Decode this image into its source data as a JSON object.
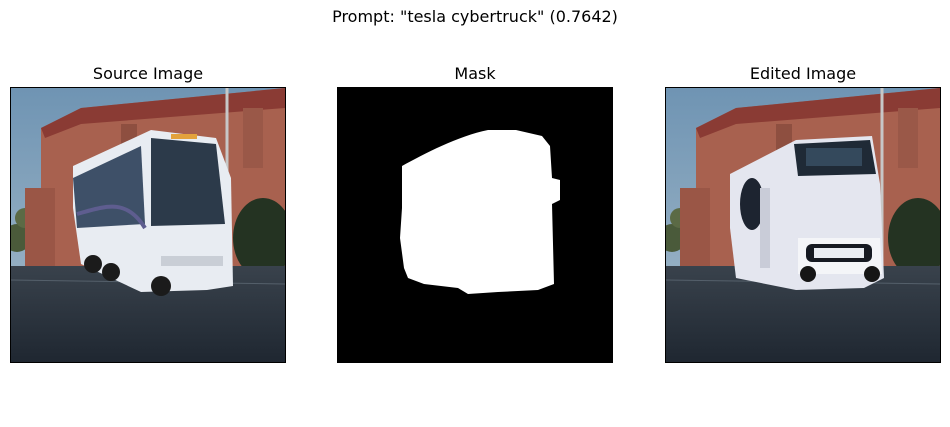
{
  "figure": {
    "title": "Prompt: \"tesla cybertruck\" (0.7642)"
  },
  "panels": [
    {
      "title": "Source Image"
    },
    {
      "title": "Mask"
    },
    {
      "title": "Edited Image"
    }
  ],
  "colors": {
    "sky": "#7f9fb8",
    "brick": "#a8614f",
    "roof": "#8a3b34",
    "pavement": "#2e3640",
    "bus_body": "#e8ecf2",
    "mask_bg": "#000000",
    "mask_fg": "#ffffff"
  }
}
